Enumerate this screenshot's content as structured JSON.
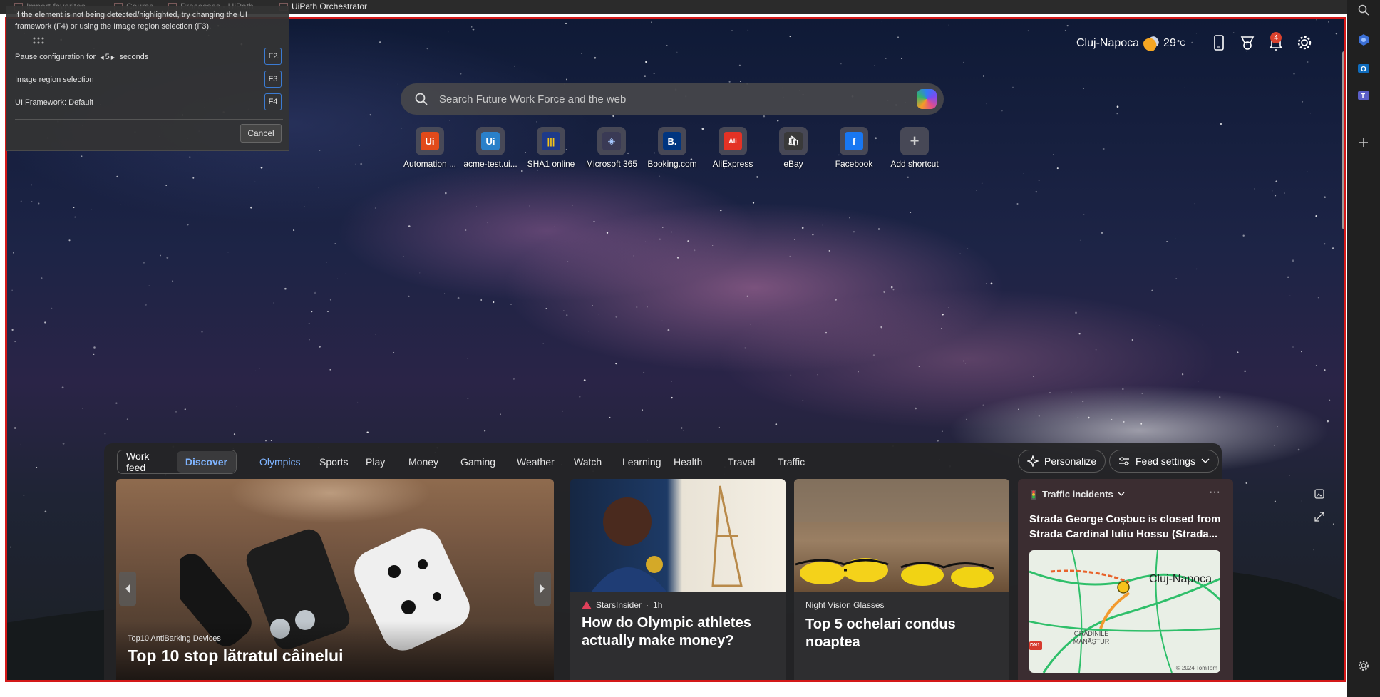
{
  "topbar": {
    "favorites": [
      {
        "label": "Import favorites"
      },
      {
        "label": "Course"
      },
      {
        "label": "Processes - UiPath..."
      },
      {
        "label": "UiPath Orchestrator"
      }
    ]
  },
  "dialog": {
    "message": "If the element is not being detected/highlighted, try changing the UI framework (F4) or using the Image region selection (F3).",
    "pause_prefix": "Pause configuration for",
    "pause_value": "5",
    "pause_suffix": "seconds",
    "pause_key": "F2",
    "image_region_label": "Image region selection",
    "image_region_key": "F3",
    "framework_label": "UI Framework: Default",
    "framework_key": "F4",
    "cancel_label": "Cancel"
  },
  "header": {
    "city": "Cluj-Napoca",
    "temperature": "29",
    "temp_unit": "°C",
    "notification_count": "4"
  },
  "search": {
    "placeholder": "Search Future Work Force and the web"
  },
  "shortcuts": [
    {
      "label": "Automation ...",
      "logo": "Ui",
      "color": "#e24a1a",
      "text_color": "#ffffff"
    },
    {
      "label": "acme-test.ui...",
      "logo": "Ui",
      "color": "#2a80c9",
      "text_color": "#ffffff"
    },
    {
      "label": "SHA1 online",
      "logo": "|||",
      "color": "#1e3a8a",
      "text_color": "#f5c518"
    },
    {
      "label": "Microsoft 365",
      "logo": "◈",
      "color": "#3a3a55",
      "text_color": "#a6c8ff"
    },
    {
      "label": "Booking.com",
      "logo": "B.",
      "color": "#003580",
      "text_color": "#ffffff"
    },
    {
      "label": "AliExpress",
      "logo": "Ali",
      "color": "#e43225",
      "text_color": "#ffffff"
    },
    {
      "label": "eBay",
      "logo": "🛍",
      "color": "#3a3a3a",
      "text_color": "#ffffff"
    },
    {
      "label": "Facebook",
      "logo": "f",
      "color": "#1877f2",
      "text_color": "#ffffff"
    },
    {
      "label": "Add shortcut",
      "logo": "+",
      "color": "transparent",
      "text_color": "#cfcfcf"
    }
  ],
  "feed": {
    "toggle": {
      "work": "Work feed",
      "discover": "Discover"
    },
    "tabs": [
      "Olympics",
      "Sports",
      "Play",
      "Money",
      "Gaming",
      "Weather",
      "Watch",
      "Learning",
      "Health",
      "Travel",
      "Traffic"
    ],
    "active_tab": "Olympics",
    "personalize_label": "Personalize",
    "feed_settings_label": "Feed settings",
    "cards": {
      "card1": {
        "source": "Top10 AntiBarking Devices",
        "headline": "Top 10 stop lătratul câinelui"
      },
      "card2": {
        "source": "StarsInsider",
        "age": "1h",
        "headline": "How do Olympic athletes actually make money?"
      },
      "card3": {
        "source": "Night Vision Glasses",
        "headline": "Top 5 ochelari condus noaptea"
      },
      "card4": {
        "title": "Traffic incidents",
        "headline": "Strada George Coșbuc is closed from Strada Cardinal Iuliu Hossu (Strada...",
        "map_city": "Cluj-Napoca",
        "map_district": "GRĂDINILE MANĂȘTUR",
        "map_road": "DN1",
        "map_credit": "© 2024 TomTom"
      }
    }
  },
  "colors": {
    "frame_red": "#d41919",
    "accent_blue": "#7fb4ff",
    "badge_red": "#d9422e"
  }
}
